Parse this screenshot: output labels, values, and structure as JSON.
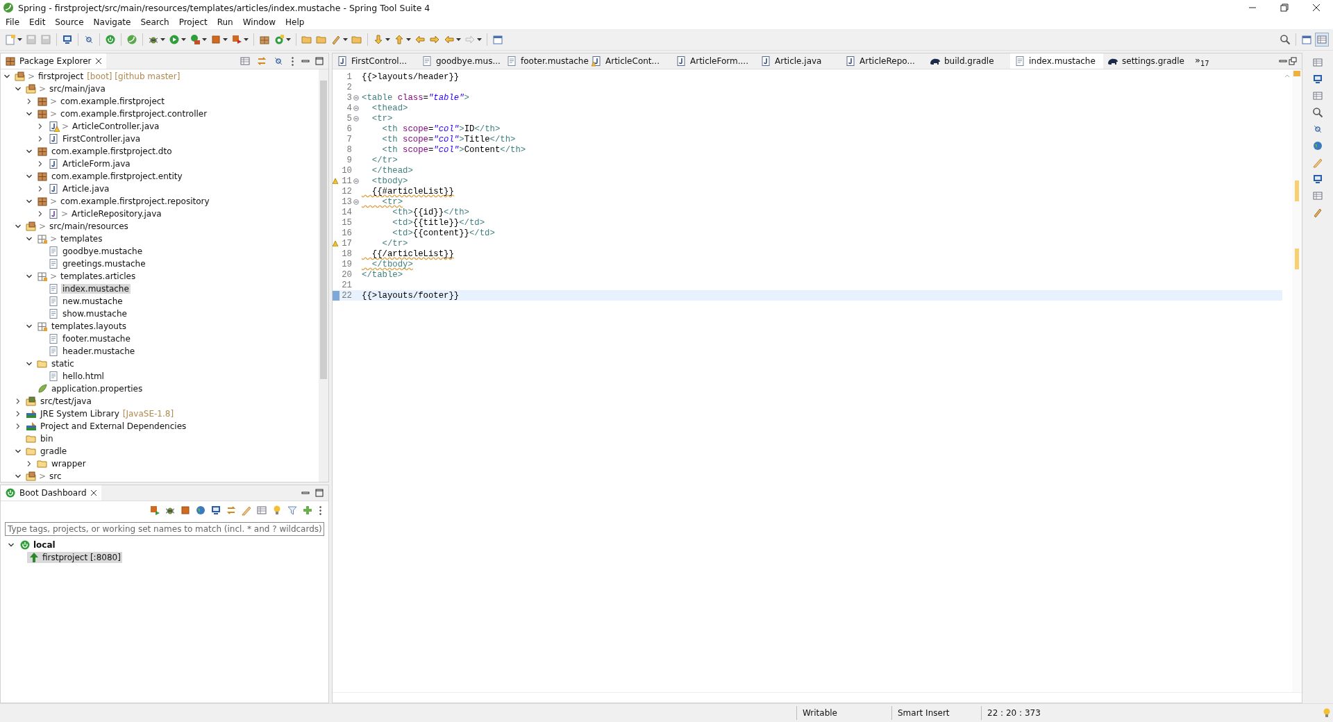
{
  "window": {
    "title": "Spring - firstproject/src/main/resources/templates/articles/index.mustache - Spring Tool Suite 4"
  },
  "menu": [
    "File",
    "Edit",
    "Source",
    "Navigate",
    "Search",
    "Project",
    "Run",
    "Window",
    "Help"
  ],
  "package_explorer": {
    "title": "Package Explorer",
    "tree": [
      {
        "label": "firstproject",
        "kind": "project",
        "prefix": ">",
        "decoration": "[boot] [github master]",
        "expanded": true,
        "selected": false,
        "children": [
          {
            "label": "src/main/java",
            "kind": "source-folder",
            "prefix": ">",
            "expanded": true,
            "selected": false,
            "children": [
              {
                "label": "com.example.firstproject",
                "kind": "package",
                "prefix": ">",
                "expanded": false,
                "selected": false
              },
              {
                "label": "com.example.firstproject.controller",
                "kind": "package",
                "prefix": ">",
                "expanded": true,
                "selected": false,
                "children": [
                  {
                    "label": "ArticleController.java",
                    "kind": "java",
                    "prefix": ">",
                    "warning": true,
                    "expanded": false,
                    "selected": false
                  },
                  {
                    "label": "FirstController.java",
                    "kind": "java",
                    "expanded": false,
                    "selected": false
                  }
                ]
              },
              {
                "label": "com.example.firstproject.dto",
                "kind": "package",
                "expanded": true,
                "selected": false,
                "children": [
                  {
                    "label": "ArticleForm.java",
                    "kind": "java",
                    "expanded": false,
                    "selected": false
                  }
                ]
              },
              {
                "label": "com.example.firstproject.entity",
                "kind": "package",
                "expanded": true,
                "selected": false,
                "children": [
                  {
                    "label": "Article.java",
                    "kind": "java",
                    "expanded": false,
                    "selected": false
                  }
                ]
              },
              {
                "label": "com.example.firstproject.repository",
                "kind": "package",
                "prefix": ">",
                "expanded": true,
                "selected": false,
                "children": [
                  {
                    "label": "ArticleRepository.java",
                    "kind": "interface",
                    "prefix": ">",
                    "expanded": false,
                    "selected": false
                  }
                ]
              }
            ]
          },
          {
            "label": "src/main/resources",
            "kind": "source-folder",
            "prefix": ">",
            "expanded": true,
            "selected": false,
            "children": [
              {
                "label": "templates",
                "kind": "res-package",
                "prefix": ">",
                "expanded": true,
                "selected": false,
                "children": [
                  {
                    "label": "goodbye.mustache",
                    "kind": "file",
                    "selected": false
                  },
                  {
                    "label": "greetings.mustache",
                    "kind": "file",
                    "selected": false
                  }
                ]
              },
              {
                "label": "templates.articles",
                "kind": "res-package",
                "prefix": ">",
                "expanded": true,
                "selected": false,
                "children": [
                  {
                    "label": "index.mustache",
                    "kind": "file",
                    "selected": true
                  },
                  {
                    "label": "new.mustache",
                    "kind": "file",
                    "selected": false
                  },
                  {
                    "label": "show.mustache",
                    "kind": "file",
                    "selected": false
                  }
                ]
              },
              {
                "label": "templates.layouts",
                "kind": "res-package",
                "expanded": true,
                "selected": false,
                "children": [
                  {
                    "label": "footer.mustache",
                    "kind": "file",
                    "selected": false
                  },
                  {
                    "label": "header.mustache",
                    "kind": "file",
                    "selected": false
                  }
                ]
              },
              {
                "label": "static",
                "kind": "folder",
                "expanded": true,
                "selected": false,
                "children": [
                  {
                    "label": "hello.html",
                    "kind": "file",
                    "selected": false
                  }
                ]
              },
              {
                "label": "application.properties",
                "kind": "properties",
                "selected": false
              }
            ]
          },
          {
            "label": "src/test/java",
            "kind": "test-folder",
            "expanded": false,
            "selected": false
          },
          {
            "label": "JRE System Library",
            "kind": "library",
            "decoration": "[JavaSE-1.8]",
            "expanded": false,
            "selected": false
          },
          {
            "label": "Project and External Dependencies",
            "kind": "library",
            "expanded": false,
            "selected": false
          },
          {
            "label": "bin",
            "kind": "folder",
            "selected": false
          },
          {
            "label": "gradle",
            "kind": "folder",
            "expanded": true,
            "selected": false,
            "children": [
              {
                "label": "wrapper",
                "kind": "folder",
                "expanded": false,
                "selected": false
              }
            ]
          },
          {
            "label": "src",
            "kind": "source-folder",
            "prefix": ">",
            "expanded": true,
            "selected": false
          }
        ]
      }
    ]
  },
  "editor": {
    "tabs": [
      {
        "label": "FirstControl...",
        "kind": "java",
        "selected": false
      },
      {
        "label": "goodbye.mus...",
        "kind": "file",
        "selected": false
      },
      {
        "label": "footer.mustache",
        "kind": "file",
        "selected": false
      },
      {
        "label": "ArticleCont...",
        "kind": "java-warning",
        "selected": false
      },
      {
        "label": "ArticleForm....",
        "kind": "java",
        "selected": false
      },
      {
        "label": "Article.java",
        "kind": "java",
        "selected": false
      },
      {
        "label": "ArticleRepo...",
        "kind": "java",
        "selected": false
      },
      {
        "label": "build.gradle",
        "kind": "gradle",
        "selected": false
      },
      {
        "label": "index.mustache",
        "kind": "file",
        "selected": true
      },
      {
        "label": "settings.gradle",
        "kind": "gradle",
        "selected": false
      }
    ],
    "overflow": {
      "symbol": "»",
      "count": "17"
    },
    "lines": [
      {
        "number": "1",
        "tokens": [
          {
            "kind": "text",
            "text": "{{>layouts/header}}"
          }
        ]
      },
      {
        "number": "2"
      },
      {
        "number": "3",
        "fold": true,
        "tokens": [
          {
            "kind": "tag",
            "text": "<table"
          },
          {
            "kind": "attr",
            "text": " class"
          },
          {
            "kind": "text",
            "text": "="
          },
          {
            "kind": "str",
            "text": "\"table\""
          },
          {
            "kind": "tag",
            "text": ">"
          }
        ]
      },
      {
        "number": "4",
        "fold": true,
        "tokens": [
          {
            "kind": "tag",
            "text": "  <thead>"
          }
        ]
      },
      {
        "number": "5",
        "fold": true,
        "tokens": [
          {
            "kind": "tag",
            "text": "  <tr>"
          }
        ]
      },
      {
        "number": "6",
        "tokens": [
          {
            "kind": "tag",
            "text": "    <th"
          },
          {
            "kind": "attr",
            "text": " scope"
          },
          {
            "kind": "text",
            "text": "="
          },
          {
            "kind": "str",
            "text": "\"col\""
          },
          {
            "kind": "tag",
            "text": ">"
          },
          {
            "kind": "text",
            "text": "ID"
          },
          {
            "kind": "tag",
            "text": "</th>"
          }
        ]
      },
      {
        "number": "7",
        "tokens": [
          {
            "kind": "tag",
            "text": "    <th"
          },
          {
            "kind": "attr",
            "text": " scope"
          },
          {
            "kind": "text",
            "text": "="
          },
          {
            "kind": "str",
            "text": "\"col\""
          },
          {
            "kind": "tag",
            "text": ">"
          },
          {
            "kind": "text",
            "text": "Title"
          },
          {
            "kind": "tag",
            "text": "</th>"
          }
        ]
      },
      {
        "number": "8",
        "tokens": [
          {
            "kind": "tag",
            "text": "    <th"
          },
          {
            "kind": "attr",
            "text": " scope"
          },
          {
            "kind": "text",
            "text": "="
          },
          {
            "kind": "str",
            "text": "\"col\""
          },
          {
            "kind": "tag",
            "text": ">"
          },
          {
            "kind": "text",
            "text": "Content"
          },
          {
            "kind": "tag",
            "text": "</th>"
          }
        ]
      },
      {
        "number": "9",
        "tokens": [
          {
            "kind": "tag",
            "text": "  </tr>"
          }
        ]
      },
      {
        "number": "10",
        "tokens": [
          {
            "kind": "tag",
            "text": "  </thead>"
          }
        ]
      },
      {
        "number": "11",
        "fold": true,
        "warning": true,
        "tokens": [
          {
            "kind": "tag",
            "text": "  <tbody>"
          }
        ]
      },
      {
        "number": "12",
        "squiggle": true,
        "tokens": [
          {
            "kind": "text",
            "text": "  {{#articleList}}"
          }
        ]
      },
      {
        "number": "13",
        "fold": true,
        "squiggle": true,
        "tokens": [
          {
            "kind": "tag",
            "text": "    <tr>"
          }
        ]
      },
      {
        "number": "14",
        "tokens": [
          {
            "kind": "tag",
            "text": "      <th>"
          },
          {
            "kind": "text",
            "text": "{{id}}"
          },
          {
            "kind": "tag",
            "text": "</th>"
          }
        ]
      },
      {
        "number": "15",
        "tokens": [
          {
            "kind": "tag",
            "text": "      <td>"
          },
          {
            "kind": "text",
            "text": "{{title}}"
          },
          {
            "kind": "tag",
            "text": "</td>"
          }
        ]
      },
      {
        "number": "16",
        "tokens": [
          {
            "kind": "tag",
            "text": "      <td>"
          },
          {
            "kind": "text",
            "text": "{{content}}"
          },
          {
            "kind": "tag",
            "text": "</td>"
          }
        ]
      },
      {
        "number": "17",
        "warning": true,
        "tokens": [
          {
            "kind": "tag",
            "text": "    </tr>"
          }
        ]
      },
      {
        "number": "18",
        "squiggle": true,
        "tokens": [
          {
            "kind": "text",
            "text": "  {{/articleList}}"
          }
        ]
      },
      {
        "number": "19",
        "squiggle": true,
        "tokens": [
          {
            "kind": "tag",
            "text": "  </tbody>"
          }
        ]
      },
      {
        "number": "20",
        "tokens": [
          {
            "kind": "tag",
            "text": "</table>"
          }
        ]
      },
      {
        "number": "21"
      },
      {
        "number": "22",
        "current": true,
        "tokens": [
          {
            "kind": "text",
            "text": "{{>layouts/footer}}"
          }
        ]
      }
    ]
  },
  "boot_dashboard": {
    "title": "Boot Dashboard",
    "filter": {
      "placeholder": "Type tags, projects, or working set names to match (incl. * and ? wildcards)"
    },
    "tree": [
      {
        "label": "local",
        "expanded": true,
        "children": [
          {
            "label": "firstproject [:8080]",
            "running": true,
            "selected": true
          }
        ]
      }
    ]
  },
  "status_bar": {
    "mode": "Writable",
    "insert": "Smart Insert",
    "position": "22 : 20 : 373"
  }
}
